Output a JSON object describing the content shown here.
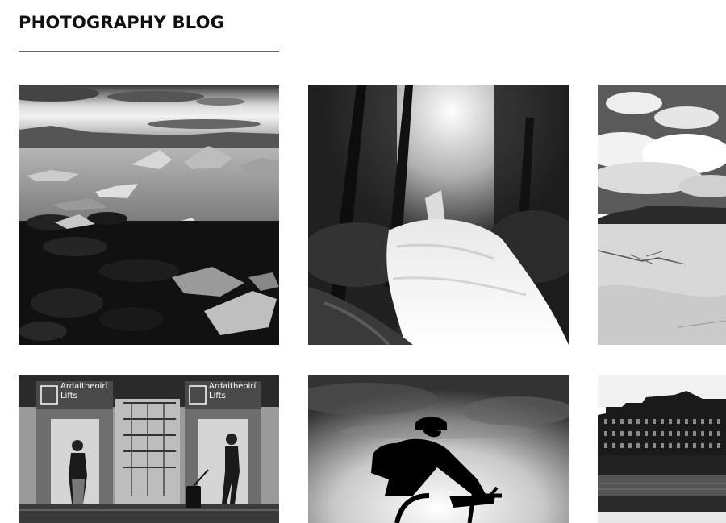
{
  "blog": {
    "title": "PHOTOGRAPHY BLOG"
  },
  "photos": [
    {
      "name": "icebergs-lagoon",
      "subject": "icebergs floating in a lagoon"
    },
    {
      "name": "forest-waterfall",
      "subject": "waterfall in a forest"
    },
    {
      "name": "desert-dunes",
      "subject": "sand dunes under a cloudy sky"
    },
    {
      "name": "airport-lifts",
      "subject": "travellers at airport lifts",
      "signs": [
        {
          "line1": "Ardaitheoirí",
          "line2": "Lifts"
        },
        {
          "line1": "Ardaitheoirí",
          "line2": "Lifts"
        }
      ]
    },
    {
      "name": "cyclist-silhouette",
      "subject": "silhouette of a cyclist"
    },
    {
      "name": "waterfront-building",
      "subject": "waterfront building"
    }
  ],
  "colors": {
    "title": "#111111",
    "rule": "#666666",
    "background": "#ffffff"
  }
}
